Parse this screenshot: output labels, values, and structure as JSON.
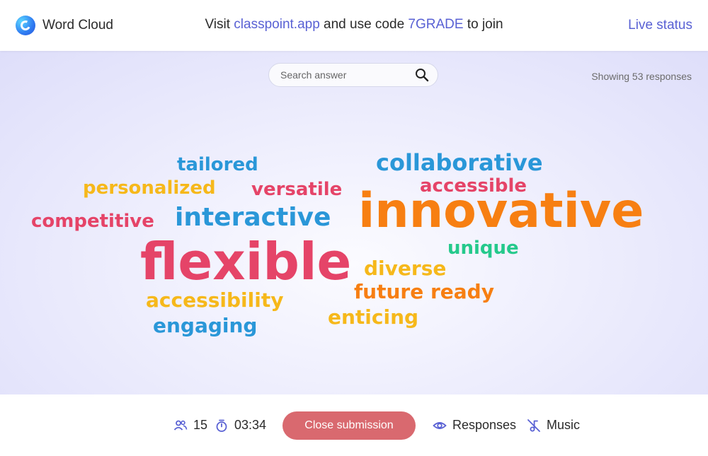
{
  "header": {
    "app_title": "Word Cloud",
    "join_prefix": "Visit ",
    "join_url": "classpoint.app",
    "join_middle": " and use code ",
    "join_code": "7GRADE",
    "join_suffix": " to join",
    "live_status": "Live status"
  },
  "search": {
    "placeholder": "Search answer"
  },
  "showing_text": "Showing 53 responses",
  "words": [
    {
      "text": "tailored",
      "color": "#2a97d8"
    },
    {
      "text": "collaborative",
      "color": "#2a97d8"
    },
    {
      "text": "personalized",
      "color": "#f6b81a"
    },
    {
      "text": "versatile",
      "color": "#e54468"
    },
    {
      "text": "accessible",
      "color": "#e54468"
    },
    {
      "text": "competitive",
      "color": "#e54468"
    },
    {
      "text": "interactive",
      "color": "#2a97d8"
    },
    {
      "text": "innovative",
      "color": "#f77f12"
    },
    {
      "text": "flexible",
      "color": "#e54468"
    },
    {
      "text": "unique",
      "color": "#25c98c"
    },
    {
      "text": "diverse",
      "color": "#f6b81a"
    },
    {
      "text": "future ready",
      "color": "#f77f12"
    },
    {
      "text": "accessibility",
      "color": "#f6b81a"
    },
    {
      "text": "enticing",
      "color": "#f6b81a"
    },
    {
      "text": "engaging",
      "color": "#2a97d8"
    }
  ],
  "footer": {
    "participants": "15",
    "timer": "03:34",
    "close_label": "Close submission",
    "responses_label": "Responses",
    "music_label": "Music"
  },
  "colors": {
    "accent": "#5961d4",
    "close_button": "#d9696f"
  },
  "icons": {
    "logo": "classpoint-logo-icon",
    "search": "search-icon",
    "participants": "people-icon",
    "timer": "stopwatch-icon",
    "responses": "eye-icon",
    "music": "music-off-icon"
  }
}
